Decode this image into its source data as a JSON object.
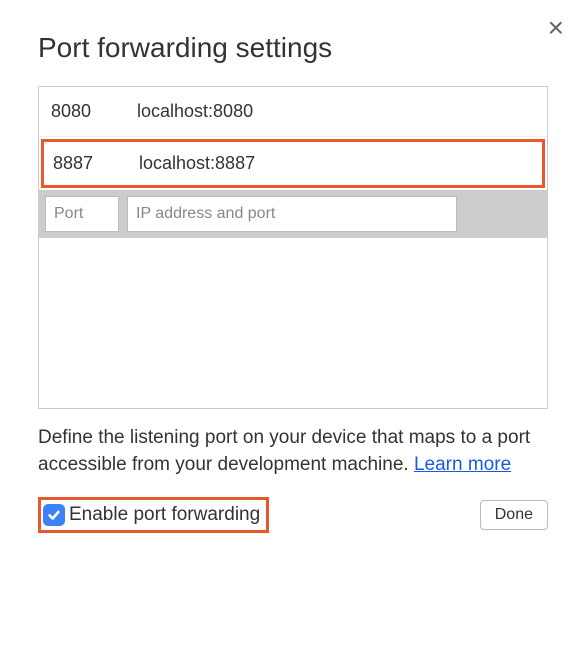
{
  "dialog": {
    "title": "Port forwarding settings",
    "close_label": "×"
  },
  "mappings": [
    {
      "port": "8080",
      "address": "localhost:8080",
      "highlighted": false
    },
    {
      "port": "8887",
      "address": "localhost:8887",
      "highlighted": true
    }
  ],
  "inputs": {
    "port_placeholder": "Port",
    "address_placeholder": "IP address and port"
  },
  "description": {
    "text": "Define the listening port on your device that maps to a port accessible from your development machine. ",
    "learn_more": "Learn more"
  },
  "footer": {
    "checkbox_label": "Enable port forwarding",
    "checkbox_checked": true,
    "done_label": "Done"
  }
}
